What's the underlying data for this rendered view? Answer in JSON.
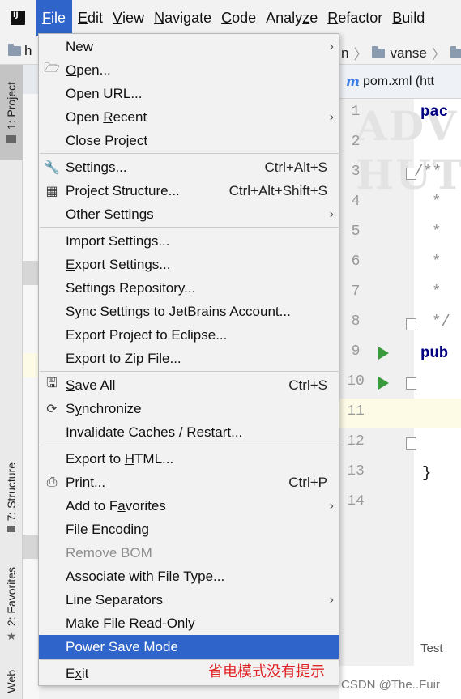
{
  "menubar": {
    "logo": "IJ",
    "items": [
      {
        "label": "File",
        "mnemonic": "F"
      },
      {
        "label": "Edit",
        "mnemonic": "E"
      },
      {
        "label": "View",
        "mnemonic": "V"
      },
      {
        "label": "Navigate",
        "mnemonic": "N"
      },
      {
        "label": "Code",
        "mnemonic": "C"
      },
      {
        "label": "Analyze",
        "mnemonic": "z"
      },
      {
        "label": "Refactor",
        "mnemonic": "R"
      },
      {
        "label": "Build",
        "mnemonic": "B"
      }
    ]
  },
  "breadcrumb": {
    "left": "h",
    "right_prefix": "n",
    "right_folder": "vanse"
  },
  "toolwindows": {
    "project": "1: Project",
    "structure": "7: Structure",
    "favorites": "2: Favorites",
    "web": "Web"
  },
  "editor": {
    "tab_icon": "m",
    "tab_label": "pom.xml (htt",
    "watermark": "ADV\nHUT",
    "line_numbers": [
      "1",
      "2",
      "3",
      "4",
      "5",
      "6",
      "7",
      "8",
      "9",
      "10",
      "11",
      "12",
      "13",
      "14"
    ],
    "code": {
      "l1": "pac",
      "l3": "/**",
      "l4": "*",
      "l5": "*",
      "l6": "*",
      "l7": "*",
      "l8": "*/",
      "l9": "pub",
      "l13": "}"
    },
    "bottom_hint": "Test",
    "watermark_credit": "CSDN @The..Fuir"
  },
  "file_menu": {
    "items": [
      {
        "label": "New",
        "mnemonic": "",
        "shortcut": "",
        "submenu": true,
        "icon": ""
      },
      {
        "label": "Open...",
        "mnemonic": "O",
        "shortcut": "",
        "submenu": false,
        "icon": "folder-open-icon"
      },
      {
        "label": "Open URL...",
        "mnemonic": "",
        "shortcut": "",
        "submenu": false,
        "icon": ""
      },
      {
        "label": "Open Recent",
        "mnemonic": "R",
        "shortcut": "",
        "submenu": true,
        "icon": ""
      },
      {
        "label": "Close Project",
        "mnemonic": "",
        "shortcut": "",
        "submenu": false,
        "icon": ""
      },
      {
        "label": "Settings...",
        "mnemonic": "t",
        "shortcut": "Ctrl+Alt+S",
        "submenu": false,
        "icon": "wrench-icon"
      },
      {
        "label": "Project Structure...",
        "mnemonic": "",
        "shortcut": "Ctrl+Alt+Shift+S",
        "submenu": false,
        "icon": "project-structure-icon"
      },
      {
        "label": "Other Settings",
        "mnemonic": "",
        "shortcut": "",
        "submenu": true,
        "icon": ""
      },
      {
        "label": "Import Settings...",
        "mnemonic": "",
        "shortcut": "",
        "submenu": false,
        "icon": ""
      },
      {
        "label": "Export Settings...",
        "mnemonic": "E",
        "shortcut": "",
        "submenu": false,
        "icon": ""
      },
      {
        "label": "Settings Repository...",
        "mnemonic": "",
        "shortcut": "",
        "submenu": false,
        "icon": ""
      },
      {
        "label": "Sync Settings to JetBrains Account...",
        "mnemonic": "",
        "shortcut": "",
        "submenu": false,
        "icon": ""
      },
      {
        "label": "Export Project to Eclipse...",
        "mnemonic": "",
        "shortcut": "",
        "submenu": false,
        "icon": ""
      },
      {
        "label": "Export to Zip File...",
        "mnemonic": "",
        "shortcut": "",
        "submenu": false,
        "icon": ""
      },
      {
        "label": "Save All",
        "mnemonic": "S",
        "shortcut": "Ctrl+S",
        "submenu": false,
        "icon": "save-icon"
      },
      {
        "label": "Synchronize",
        "mnemonic": "y",
        "shortcut": "",
        "submenu": false,
        "icon": "sync-icon"
      },
      {
        "label": "Invalidate Caches / Restart...",
        "mnemonic": "",
        "shortcut": "",
        "submenu": false,
        "icon": ""
      },
      {
        "label": "Export to HTML...",
        "mnemonic": "H",
        "shortcut": "",
        "submenu": false,
        "icon": ""
      },
      {
        "label": "Print...",
        "mnemonic": "P",
        "shortcut": "Ctrl+P",
        "submenu": false,
        "icon": "printer-icon"
      },
      {
        "label": "Add to Favorites",
        "mnemonic": "a",
        "shortcut": "",
        "submenu": true,
        "icon": ""
      },
      {
        "label": "File Encoding",
        "mnemonic": "",
        "shortcut": "",
        "submenu": false,
        "icon": ""
      },
      {
        "label": "Remove BOM",
        "mnemonic": "",
        "shortcut": "",
        "submenu": false,
        "icon": "",
        "disabled": true
      },
      {
        "label": "Associate with File Type...",
        "mnemonic": "",
        "shortcut": "",
        "submenu": false,
        "icon": ""
      },
      {
        "label": "Line Separators",
        "mnemonic": "",
        "shortcut": "",
        "submenu": true,
        "icon": ""
      },
      {
        "label": "Make File Read-Only",
        "mnemonic": "",
        "shortcut": "",
        "submenu": false,
        "icon": ""
      },
      {
        "label": "Power Save Mode",
        "mnemonic": "",
        "shortcut": "",
        "submenu": false,
        "icon": "",
        "highlighted": true
      },
      {
        "label": "Exit",
        "mnemonic": "x",
        "shortcut": "",
        "submenu": false,
        "icon": ""
      }
    ]
  },
  "annotation": "省电模式没有提示",
  "colors": {
    "accent": "#2f65ca",
    "menu_bg": "#f2f2f2",
    "annotation": "#e02424",
    "run_green": "#3a9b3a"
  }
}
